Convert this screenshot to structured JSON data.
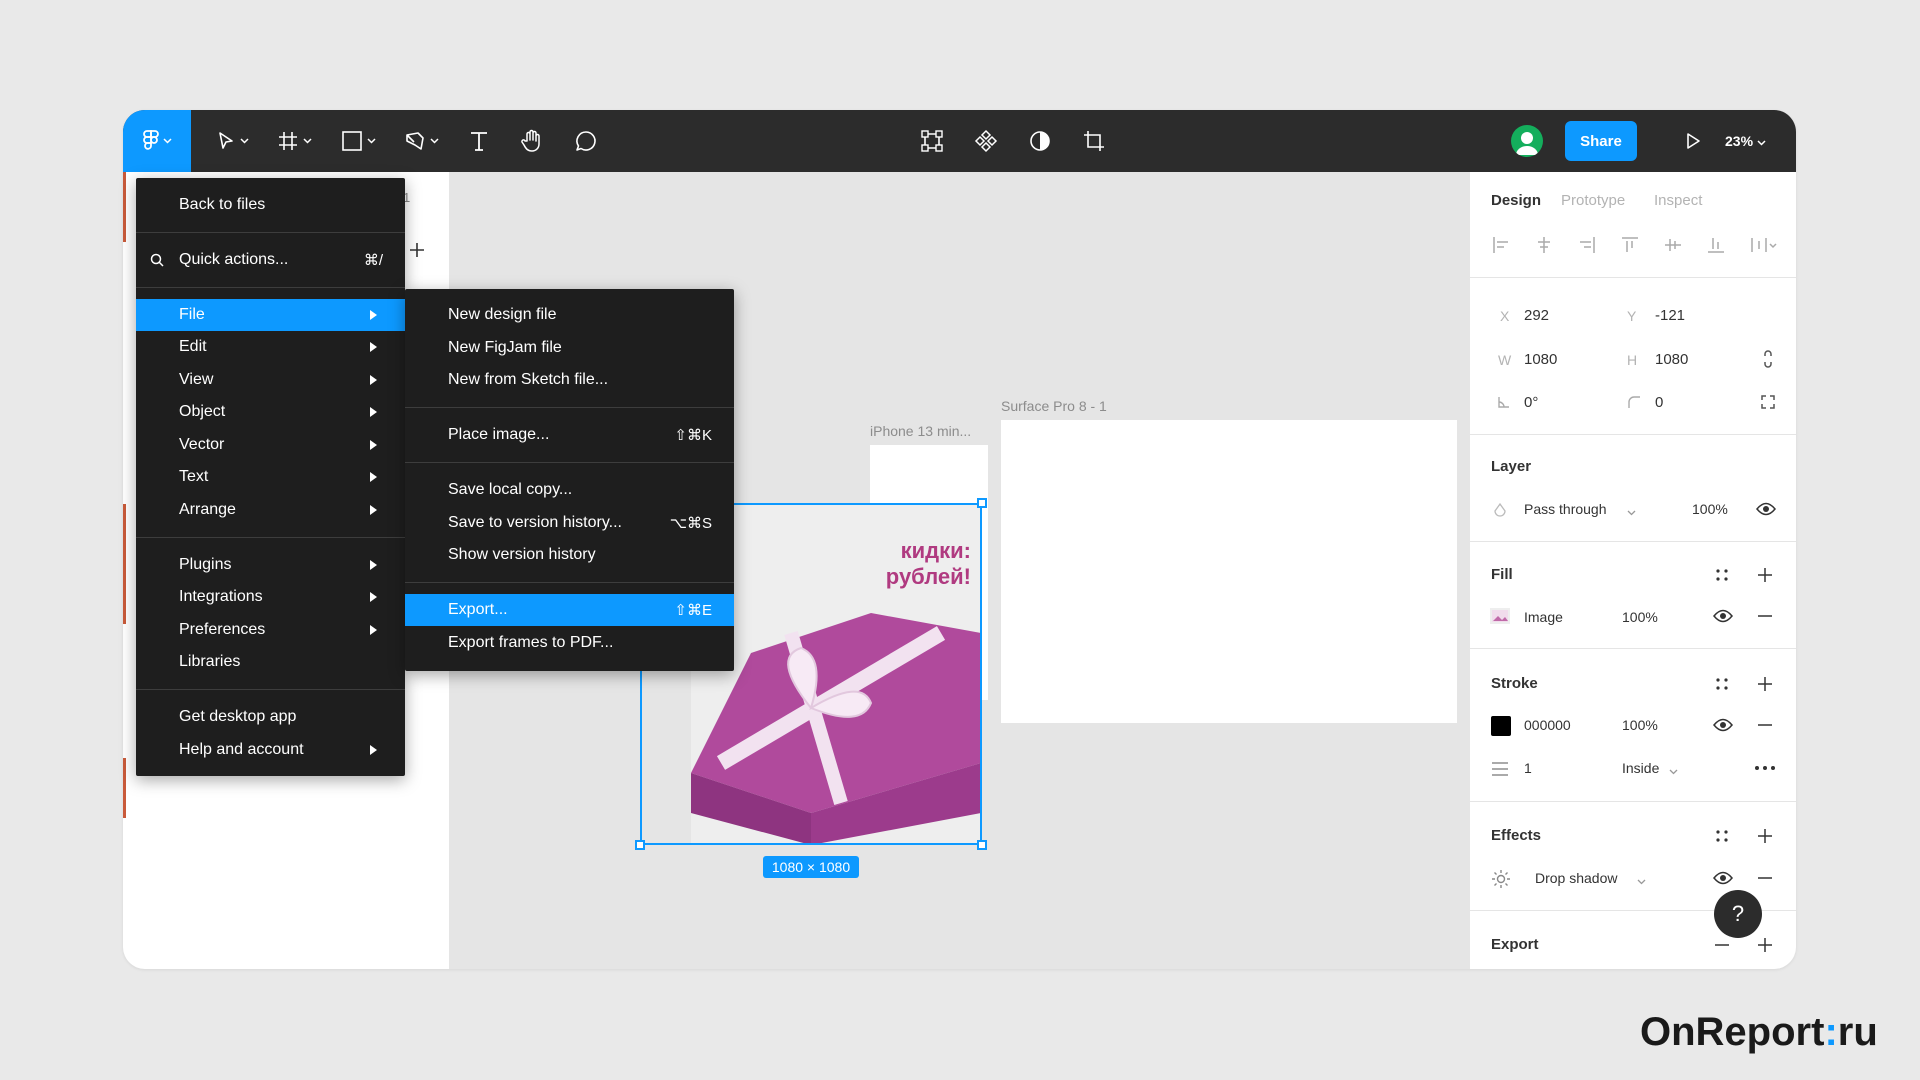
{
  "toolbar": {
    "share_label": "Share",
    "zoom": "23%"
  },
  "left_panel": {
    "page_number": "1"
  },
  "main_menu": {
    "items": [
      {
        "label": "Back to files"
      },
      {
        "label": "Quick actions...",
        "shortcut": "⌘/"
      },
      {
        "label": "File"
      },
      {
        "label": "Edit"
      },
      {
        "label": "View"
      },
      {
        "label": "Object"
      },
      {
        "label": "Vector"
      },
      {
        "label": "Text"
      },
      {
        "label": "Arrange"
      },
      {
        "label": "Plugins"
      },
      {
        "label": "Integrations"
      },
      {
        "label": "Preferences"
      },
      {
        "label": "Libraries"
      },
      {
        "label": "Get desktop app"
      },
      {
        "label": "Help and account"
      }
    ]
  },
  "file_submenu": {
    "items": [
      {
        "label": "New design file"
      },
      {
        "label": "New FigJam file"
      },
      {
        "label": "New from Sketch file..."
      },
      {
        "label": "Place image...",
        "shortcut": "⇧⌘K"
      },
      {
        "label": "Save local copy..."
      },
      {
        "label": "Save to version history...",
        "shortcut": "⌥⌘S"
      },
      {
        "label": "Show version history"
      },
      {
        "label": "Export...",
        "shortcut": "⇧⌘E"
      },
      {
        "label": "Export frames to PDF..."
      }
    ]
  },
  "canvas": {
    "frame_iphone_label": "iPhone 13 min...",
    "frame_surface_label": "Surface Pro 8 - 1",
    "promo_line1": "кидки:",
    "promo_line2": "рублей!",
    "selection_size": "1080 × 1080"
  },
  "design_panel": {
    "tabs": [
      "Design",
      "Prototype",
      "Inspect"
    ],
    "x_label": "X",
    "x_value": "292",
    "y_label": "Y",
    "y_value": "-121",
    "w_label": "W",
    "w_value": "1080",
    "h_label": "H",
    "h_value": "1080",
    "rotation": "0°",
    "corner_radius": "0",
    "layer_title": "Layer",
    "blend_mode": "Pass through",
    "layer_opacity": "100%",
    "fill_title": "Fill",
    "fill_type": "Image",
    "fill_opacity": "100%",
    "stroke_title": "Stroke",
    "stroke_color": "000000",
    "stroke_opacity": "100%",
    "stroke_weight": "1",
    "stroke_position": "Inside",
    "effects_title": "Effects",
    "effect_type": "Drop shadow",
    "export_title": "Export"
  },
  "help_label": "?",
  "brand": {
    "part1": "OnReport",
    "dot": ":",
    "part2": "ru"
  },
  "colors": {
    "accent": "#0d99ff",
    "toolbar": "#2c2c2c",
    "menu": "#1e1e1e",
    "avatar": "#14ae5c"
  }
}
